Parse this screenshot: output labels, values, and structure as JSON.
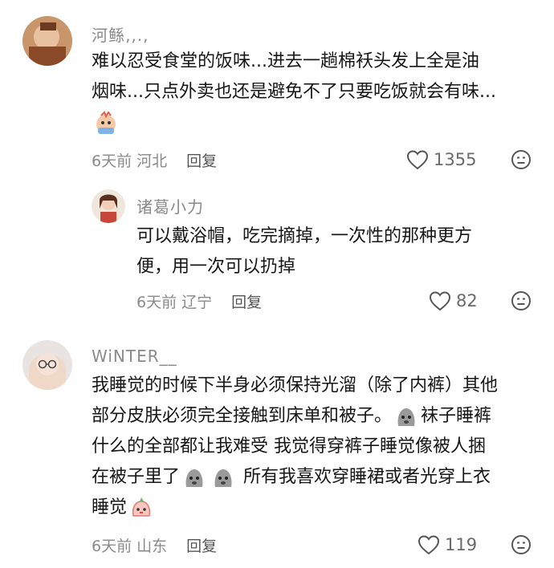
{
  "comments": [
    {
      "username": "河鲧‚,.,",
      "text_line1": "难以忍受食堂的饭味...进去一趟棉袄头发上全是油",
      "text_line2": "烟味...只点外卖也还是避免不了只要吃饭就会有味...",
      "date": "6天前",
      "location": "河北",
      "reply_label": "回复",
      "likes": "1355"
    },
    {
      "username": "诸葛小力",
      "text_line1": "可以戴浴帽，吃完摘掉，一次性的那种更方",
      "text_line2": "便，用一次可以扔掉",
      "date": "6天前",
      "location": "辽宁",
      "reply_label": "回复",
      "likes": "82"
    },
    {
      "username": "WiNTER__",
      "text_line1": "我睡觉的时候下半身必须保持光溜（除了内裤）其他",
      "text_line2a": "部分皮肤必须完全接触到床单和被子。",
      "text_line2b": "袜子睡裤",
      "text_line3": "什么的全部都让我难受 我觉得穿裤子睡觉像被人捆",
      "text_line4a": "在被子里了",
      "text_line4b": "所有我喜欢穿睡裙或者光穿上衣",
      "text_line5": "睡觉",
      "date": "6天前",
      "location": "山东",
      "reply_label": "回复",
      "likes": "119"
    }
  ],
  "colors": {
    "meta": "#8a8a8a",
    "text": "#161616",
    "icon": "#555555"
  }
}
